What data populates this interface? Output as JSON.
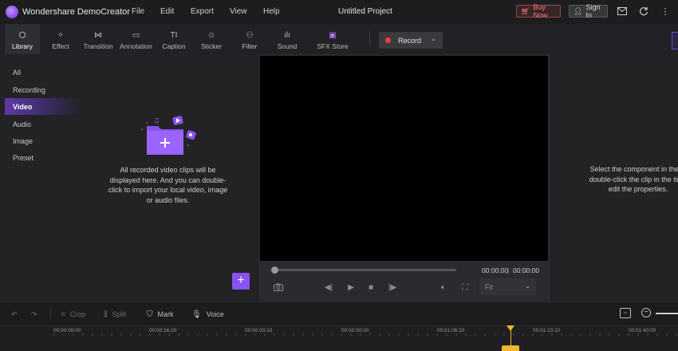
{
  "app": {
    "name": "Wondershare DemoCreator",
    "project_title": "Untitled Project",
    "menu": [
      "File",
      "Edit",
      "Export",
      "View",
      "Help"
    ],
    "buy_now": "Buy Now",
    "sign_in": "Sign In",
    "accent_color": "#8a52f0",
    "record_color": "#ff3b3b",
    "playhead_color": "#f2b52b"
  },
  "toolbar": {
    "tools": [
      {
        "label": "Library",
        "icon": "cube-icon"
      },
      {
        "label": "Effect",
        "icon": "magic-wand-icon"
      },
      {
        "label": "Transition",
        "icon": "bowtie-icon"
      },
      {
        "label": "Annotation",
        "icon": "speech-bubble-icon"
      },
      {
        "label": "Caption",
        "icon": "text-icon"
      },
      {
        "label": "Sticker",
        "icon": "smiley-icon"
      },
      {
        "label": "Filter",
        "icon": "filter-circles-icon"
      },
      {
        "label": "Sound",
        "icon": "sound-wave-icon"
      },
      {
        "label": "SFX Store",
        "icon": "store-icon"
      }
    ],
    "active_tool": "Library",
    "record_label": "Record"
  },
  "sidebar": {
    "items": [
      "All",
      "Recording",
      "Video",
      "Audio",
      "Image",
      "Preset"
    ],
    "active": "Video"
  },
  "library": {
    "empty_message_lines": [
      "All recorded video clips will be",
      "displayed here. And you can double-",
      "click to import your local video, image",
      "or audio files."
    ]
  },
  "preview": {
    "current_time": "00:00:00",
    "separator": "|",
    "total_time": "00:00:00",
    "fit_value": "Fit"
  },
  "properties": {
    "message_lines": [
      "Select the component in the pl",
      "double-click the clip in the time",
      "edit the properties."
    ]
  },
  "timeline": {
    "buttons": {
      "crop": "Crop",
      "split": "Split",
      "mark": "Mark",
      "voice": "Voice"
    },
    "ruler_labels": [
      "00:00:00:00",
      "00:00:16:20",
      "00:00:33:10",
      "00:00:50:00",
      "00:01:06:20",
      "00:01:23:10",
      "00:01:40:00"
    ]
  }
}
